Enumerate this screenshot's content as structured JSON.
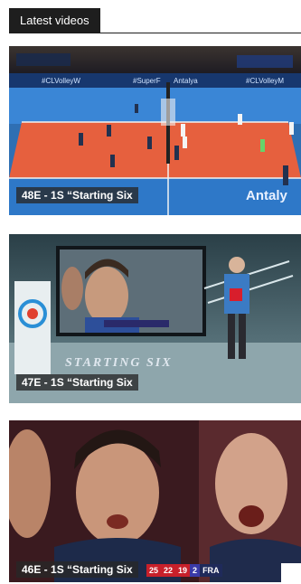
{
  "section": {
    "title": "Latest videos"
  },
  "videos": [
    {
      "title": "48E - 1S “Starting Six",
      "court_text": "Antaly",
      "banner_texts": [
        "#CLVolleyW",
        "#SuperF",
        "Antalya",
        "#CLVolleyM"
      ]
    },
    {
      "title": "47E - 1S “Starting Six",
      "overlay_text": "STARTING SIX"
    },
    {
      "title": "46E - 1S “Starting Six",
      "score_cells": [
        "25",
        "22",
        "19",
        "2",
        "FRA"
      ]
    }
  ]
}
